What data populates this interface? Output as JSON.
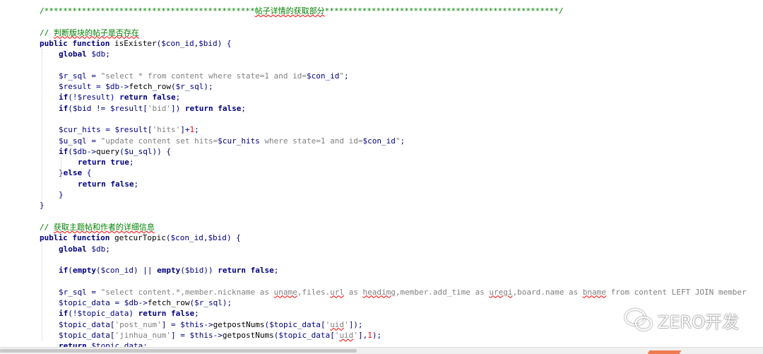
{
  "editor": {
    "lines": [
      {
        "indent": 0,
        "tokens": [
          {
            "c": "cmt",
            "t": "/*********************************************"
          },
          {
            "c": "cmt squig",
            "t": "帖子详情的获取部分"
          },
          {
            "c": "cmt",
            "t": "**************************************************/"
          }
        ]
      },
      {
        "indent": 0,
        "tokens": []
      },
      {
        "indent": 0,
        "tokens": [
          {
            "c": "cmt",
            "t": "// "
          },
          {
            "c": "cmt squig",
            "t": "判断版块的帖子是否存在"
          }
        ]
      },
      {
        "indent": 0,
        "tokens": [
          {
            "c": "kw",
            "t": "public function "
          },
          {
            "c": "fn",
            "t": "isExister"
          },
          {
            "c": "plain",
            "t": "("
          },
          {
            "c": "var",
            "t": "$con_id"
          },
          {
            "c": "plain",
            "t": ","
          },
          {
            "c": "var",
            "t": "$bid"
          },
          {
            "c": "plain",
            "t": ") {"
          }
        ]
      },
      {
        "indent": 1,
        "tokens": [
          {
            "c": "kw",
            "t": "global "
          },
          {
            "c": "var",
            "t": "$db"
          },
          {
            "c": "plain",
            "t": ";"
          }
        ]
      },
      {
        "indent": 1,
        "tokens": []
      },
      {
        "indent": 1,
        "tokens": [
          {
            "c": "var",
            "t": "$r_sql"
          },
          {
            "c": "plain",
            "t": " = "
          },
          {
            "c": "str",
            "t": "\"select * from content where state=1 and id="
          },
          {
            "c": "var",
            "t": "$con_id"
          },
          {
            "c": "str",
            "t": "\""
          },
          {
            "c": "plain",
            "t": ";"
          }
        ]
      },
      {
        "indent": 1,
        "tokens": [
          {
            "c": "var",
            "t": "$result"
          },
          {
            "c": "plain",
            "t": " = "
          },
          {
            "c": "var",
            "t": "$db"
          },
          {
            "c": "plain",
            "t": "->"
          },
          {
            "c": "fn",
            "t": "fetch_row"
          },
          {
            "c": "plain",
            "t": "("
          },
          {
            "c": "var",
            "t": "$r_sql"
          },
          {
            "c": "plain",
            "t": ");"
          }
        ]
      },
      {
        "indent": 1,
        "tokens": [
          {
            "c": "kw",
            "t": "if"
          },
          {
            "c": "plain",
            "t": "(!"
          },
          {
            "c": "var",
            "t": "$result"
          },
          {
            "c": "plain",
            "t": ") "
          },
          {
            "c": "kw",
            "t": "return false"
          },
          {
            "c": "plain",
            "t": ";"
          }
        ]
      },
      {
        "indent": 1,
        "tokens": [
          {
            "c": "kw",
            "t": "if"
          },
          {
            "c": "plain",
            "t": "("
          },
          {
            "c": "var",
            "t": "$bid"
          },
          {
            "c": "plain",
            "t": " != "
          },
          {
            "c": "var",
            "t": "$result"
          },
          {
            "c": "plain",
            "t": "["
          },
          {
            "c": "str",
            "t": "'bid'"
          },
          {
            "c": "plain",
            "t": "]) "
          },
          {
            "c": "kw",
            "t": "return false"
          },
          {
            "c": "plain",
            "t": ";"
          }
        ]
      },
      {
        "indent": 1,
        "tokens": []
      },
      {
        "indent": 1,
        "tokens": [
          {
            "c": "var",
            "t": "$cur_hits"
          },
          {
            "c": "plain",
            "t": " = "
          },
          {
            "c": "var",
            "t": "$result"
          },
          {
            "c": "plain",
            "t": "["
          },
          {
            "c": "str",
            "t": "'hits'"
          },
          {
            "c": "plain",
            "t": "]+"
          },
          {
            "c": "num",
            "t": "1"
          },
          {
            "c": "plain",
            "t": ";"
          }
        ]
      },
      {
        "indent": 1,
        "tokens": [
          {
            "c": "var",
            "t": "$u_sql"
          },
          {
            "c": "plain",
            "t": " = "
          },
          {
            "c": "str",
            "t": "\"update content set hits="
          },
          {
            "c": "var",
            "t": "$cur_hits"
          },
          {
            "c": "str",
            "t": " where state=1 and id="
          },
          {
            "c": "var",
            "t": "$con_id"
          },
          {
            "c": "str",
            "t": "\""
          },
          {
            "c": "plain",
            "t": ";"
          }
        ]
      },
      {
        "indent": 1,
        "tokens": [
          {
            "c": "kw",
            "t": "if"
          },
          {
            "c": "plain",
            "t": "("
          },
          {
            "c": "var",
            "t": "$db"
          },
          {
            "c": "plain",
            "t": "->"
          },
          {
            "c": "fn",
            "t": "query"
          },
          {
            "c": "plain",
            "t": "("
          },
          {
            "c": "var",
            "t": "$u_sql"
          },
          {
            "c": "plain",
            "t": ")) {"
          }
        ]
      },
      {
        "indent": 2,
        "tokens": [
          {
            "c": "kw",
            "t": "return true"
          },
          {
            "c": "plain",
            "t": ";"
          }
        ]
      },
      {
        "indent": 1,
        "tokens": [
          {
            "c": "plain",
            "t": "}"
          },
          {
            "c": "kw",
            "t": "else"
          },
          {
            "c": "plain",
            "t": " {"
          }
        ]
      },
      {
        "indent": 2,
        "tokens": [
          {
            "c": "kw",
            "t": "return false"
          },
          {
            "c": "plain",
            "t": ";"
          }
        ]
      },
      {
        "indent": 1,
        "tokens": [
          {
            "c": "plain",
            "t": "}"
          }
        ]
      },
      {
        "indent": 0,
        "tokens": [
          {
            "c": "plain",
            "t": "}"
          }
        ]
      },
      {
        "indent": 0,
        "tokens": []
      },
      {
        "indent": 0,
        "tokens": [
          {
            "c": "cmt",
            "t": "// "
          },
          {
            "c": "cmt squig",
            "t": "获取主题帖和作者的详细信息"
          }
        ]
      },
      {
        "indent": 0,
        "tokens": [
          {
            "c": "kw",
            "t": "public function "
          },
          {
            "c": "fn",
            "t": "getcurTopic"
          },
          {
            "c": "plain",
            "t": "("
          },
          {
            "c": "var",
            "t": "$con_id"
          },
          {
            "c": "plain",
            "t": ","
          },
          {
            "c": "var",
            "t": "$bid"
          },
          {
            "c": "plain",
            "t": ") {"
          }
        ]
      },
      {
        "indent": 1,
        "tokens": [
          {
            "c": "kw",
            "t": "global "
          },
          {
            "c": "var",
            "t": "$db"
          },
          {
            "c": "plain",
            "t": ";"
          }
        ]
      },
      {
        "indent": 1,
        "tokens": []
      },
      {
        "indent": 1,
        "tokens": [
          {
            "c": "kw",
            "t": "if"
          },
          {
            "c": "plain",
            "t": "("
          },
          {
            "c": "kw",
            "t": "empty"
          },
          {
            "c": "plain",
            "t": "("
          },
          {
            "c": "var",
            "t": "$con_id"
          },
          {
            "c": "plain",
            "t": ") || "
          },
          {
            "c": "kw",
            "t": "empty"
          },
          {
            "c": "plain",
            "t": "("
          },
          {
            "c": "var",
            "t": "$bid"
          },
          {
            "c": "plain",
            "t": ")) "
          },
          {
            "c": "kw",
            "t": "return false"
          },
          {
            "c": "plain",
            "t": ";"
          }
        ]
      },
      {
        "indent": 1,
        "tokens": []
      },
      {
        "indent": 1,
        "tokens": [
          {
            "c": "var",
            "t": "$r_sql"
          },
          {
            "c": "plain",
            "t": " = "
          },
          {
            "c": "str",
            "t": "\"select content.*,member.nickname as "
          },
          {
            "c": "str squig",
            "t": "uname"
          },
          {
            "c": "str",
            "t": ",files."
          },
          {
            "c": "str squig",
            "t": "url"
          },
          {
            "c": "str",
            "t": " as "
          },
          {
            "c": "str squig",
            "t": "headimg"
          },
          {
            "c": "str",
            "t": ",member.add_time as "
          },
          {
            "c": "str squig",
            "t": "uregi"
          },
          {
            "c": "str",
            "t": ",board.name as "
          },
          {
            "c": "str squig",
            "t": "bname"
          },
          {
            "c": "str",
            "t": " from content LEFT JOIN member"
          }
        ]
      },
      {
        "indent": 1,
        "tokens": [
          {
            "c": "var",
            "t": "$topic_data"
          },
          {
            "c": "plain",
            "t": " = "
          },
          {
            "c": "var",
            "t": "$db"
          },
          {
            "c": "plain",
            "t": "->"
          },
          {
            "c": "fn",
            "t": "fetch_row"
          },
          {
            "c": "plain",
            "t": "("
          },
          {
            "c": "var",
            "t": "$r_sql"
          },
          {
            "c": "plain",
            "t": ");"
          }
        ]
      },
      {
        "indent": 1,
        "tokens": [
          {
            "c": "kw",
            "t": "if"
          },
          {
            "c": "plain",
            "t": "(!"
          },
          {
            "c": "var",
            "t": "$topic_data"
          },
          {
            "c": "plain",
            "t": ") "
          },
          {
            "c": "kw",
            "t": "return false"
          },
          {
            "c": "plain",
            "t": ";"
          }
        ]
      },
      {
        "indent": 1,
        "tokens": [
          {
            "c": "var",
            "t": "$topic_data"
          },
          {
            "c": "plain",
            "t": "["
          },
          {
            "c": "str",
            "t": "'post_num'"
          },
          {
            "c": "plain",
            "t": "] = "
          },
          {
            "c": "var",
            "t": "$this"
          },
          {
            "c": "plain",
            "t": "->"
          },
          {
            "c": "fn",
            "t": "getpostNums"
          },
          {
            "c": "plain",
            "t": "("
          },
          {
            "c": "var",
            "t": "$topic_data"
          },
          {
            "c": "plain",
            "t": "["
          },
          {
            "c": "str",
            "t": "'"
          },
          {
            "c": "str squig",
            "t": "uid"
          },
          {
            "c": "str",
            "t": "'"
          },
          {
            "c": "plain",
            "t": "]);"
          }
        ]
      },
      {
        "indent": 1,
        "tokens": [
          {
            "c": "var",
            "t": "$topic_data"
          },
          {
            "c": "plain",
            "t": "["
          },
          {
            "c": "str",
            "t": "'jinhua_num'"
          },
          {
            "c": "plain",
            "t": "] = "
          },
          {
            "c": "var",
            "t": "$this"
          },
          {
            "c": "plain",
            "t": "->"
          },
          {
            "c": "fn",
            "t": "getpostNums"
          },
          {
            "c": "plain",
            "t": "("
          },
          {
            "c": "var",
            "t": "$topic_data"
          },
          {
            "c": "plain",
            "t": "["
          },
          {
            "c": "str",
            "t": "'"
          },
          {
            "c": "str squig",
            "t": "uid"
          },
          {
            "c": "str",
            "t": "'"
          },
          {
            "c": "plain",
            "t": "],"
          },
          {
            "c": "num",
            "t": "1"
          },
          {
            "c": "plain",
            "t": ");"
          }
        ]
      },
      {
        "indent": 1,
        "tokens": [
          {
            "c": "kw",
            "t": "return "
          },
          {
            "c": "var",
            "t": "$topic_data"
          },
          {
            "c": "plain",
            "t": ";"
          }
        ]
      }
    ]
  },
  "watermark": {
    "icon": "wechat-icon",
    "text": "ZERO开发"
  },
  "colors": {
    "comment": "#008000",
    "keyword": "#000080",
    "string": "#808080",
    "number": "#ff0000",
    "accent": "#f07a50"
  }
}
